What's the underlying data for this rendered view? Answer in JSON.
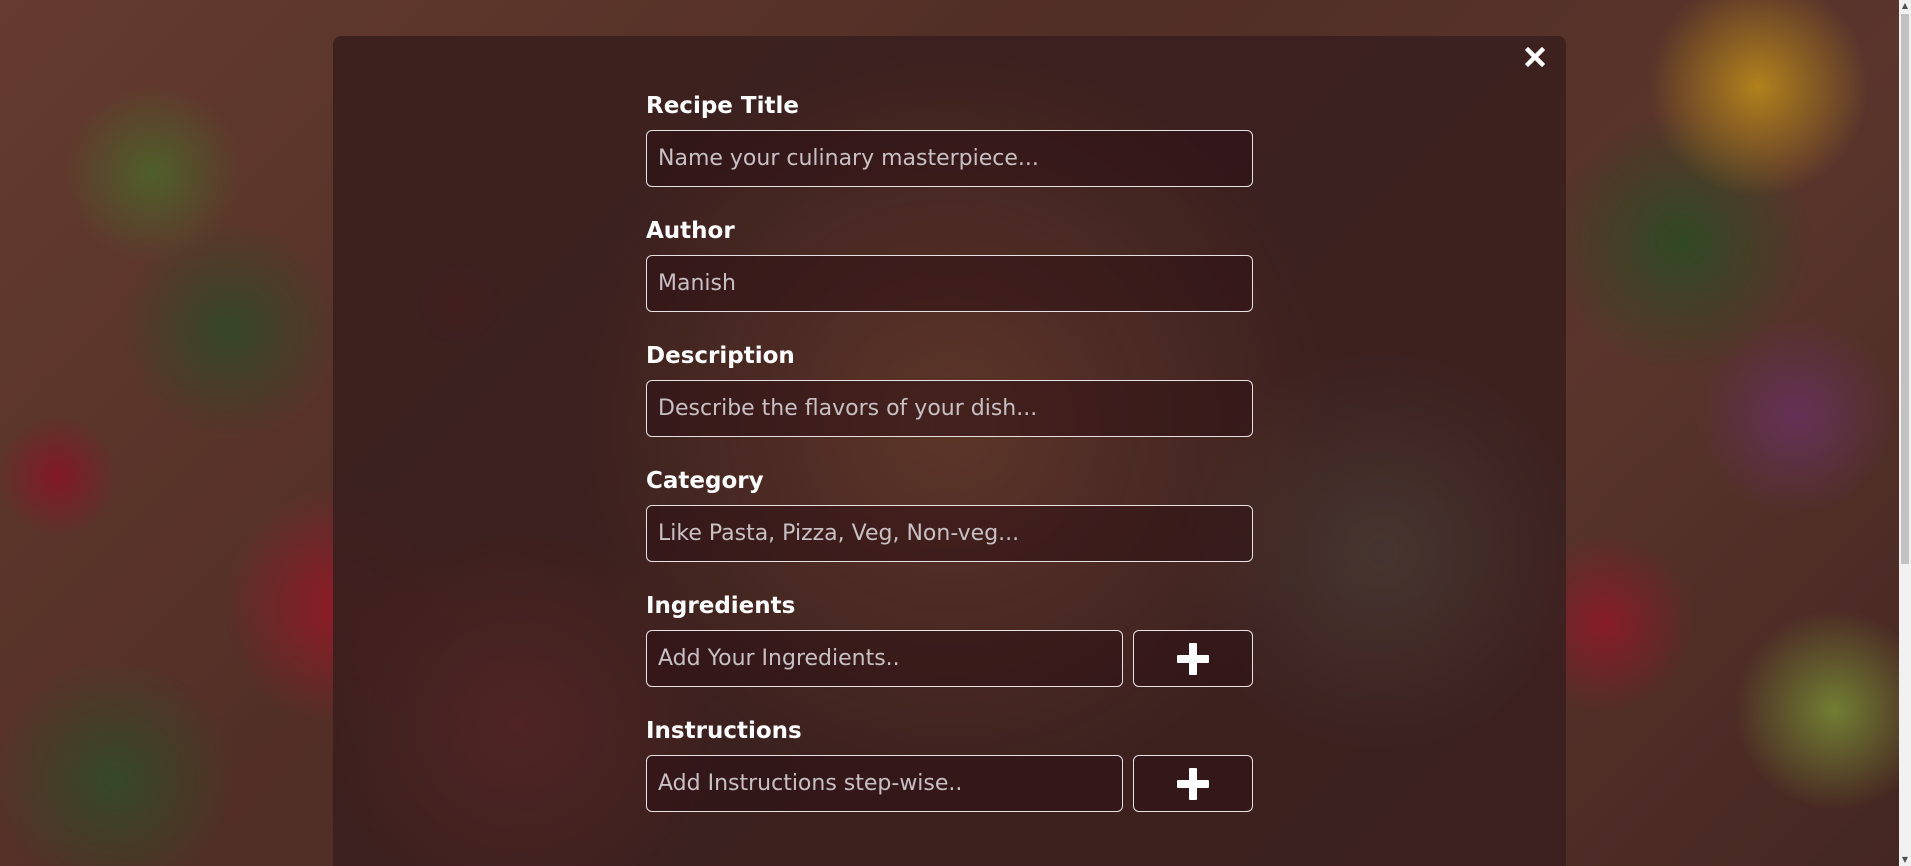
{
  "modal": {
    "close_icon": "close-icon"
  },
  "form": {
    "recipe_title": {
      "label": "Recipe Title",
      "placeholder": "Name your culinary masterpiece...",
      "value": ""
    },
    "author": {
      "label": "Author",
      "placeholder": "Manish",
      "value": ""
    },
    "description": {
      "label": "Description",
      "placeholder": "Describe the flavors of your dish...",
      "value": ""
    },
    "category": {
      "label": "Category",
      "placeholder": "Like Pasta, Pizza, Veg, Non-veg...",
      "value": ""
    },
    "ingredients": {
      "label": "Ingredients",
      "placeholder": "Add Your Ingredients..",
      "value": "",
      "add_icon": "plus-icon"
    },
    "instructions": {
      "label": "Instructions",
      "placeholder": "Add Instructions step-wise..",
      "value": "",
      "add_icon": "plus-icon"
    }
  },
  "colors": {
    "overlay": "#3a201e",
    "border": "#e8e2e2",
    "text": "#ffffff",
    "placeholder": "#c9c0c3"
  }
}
